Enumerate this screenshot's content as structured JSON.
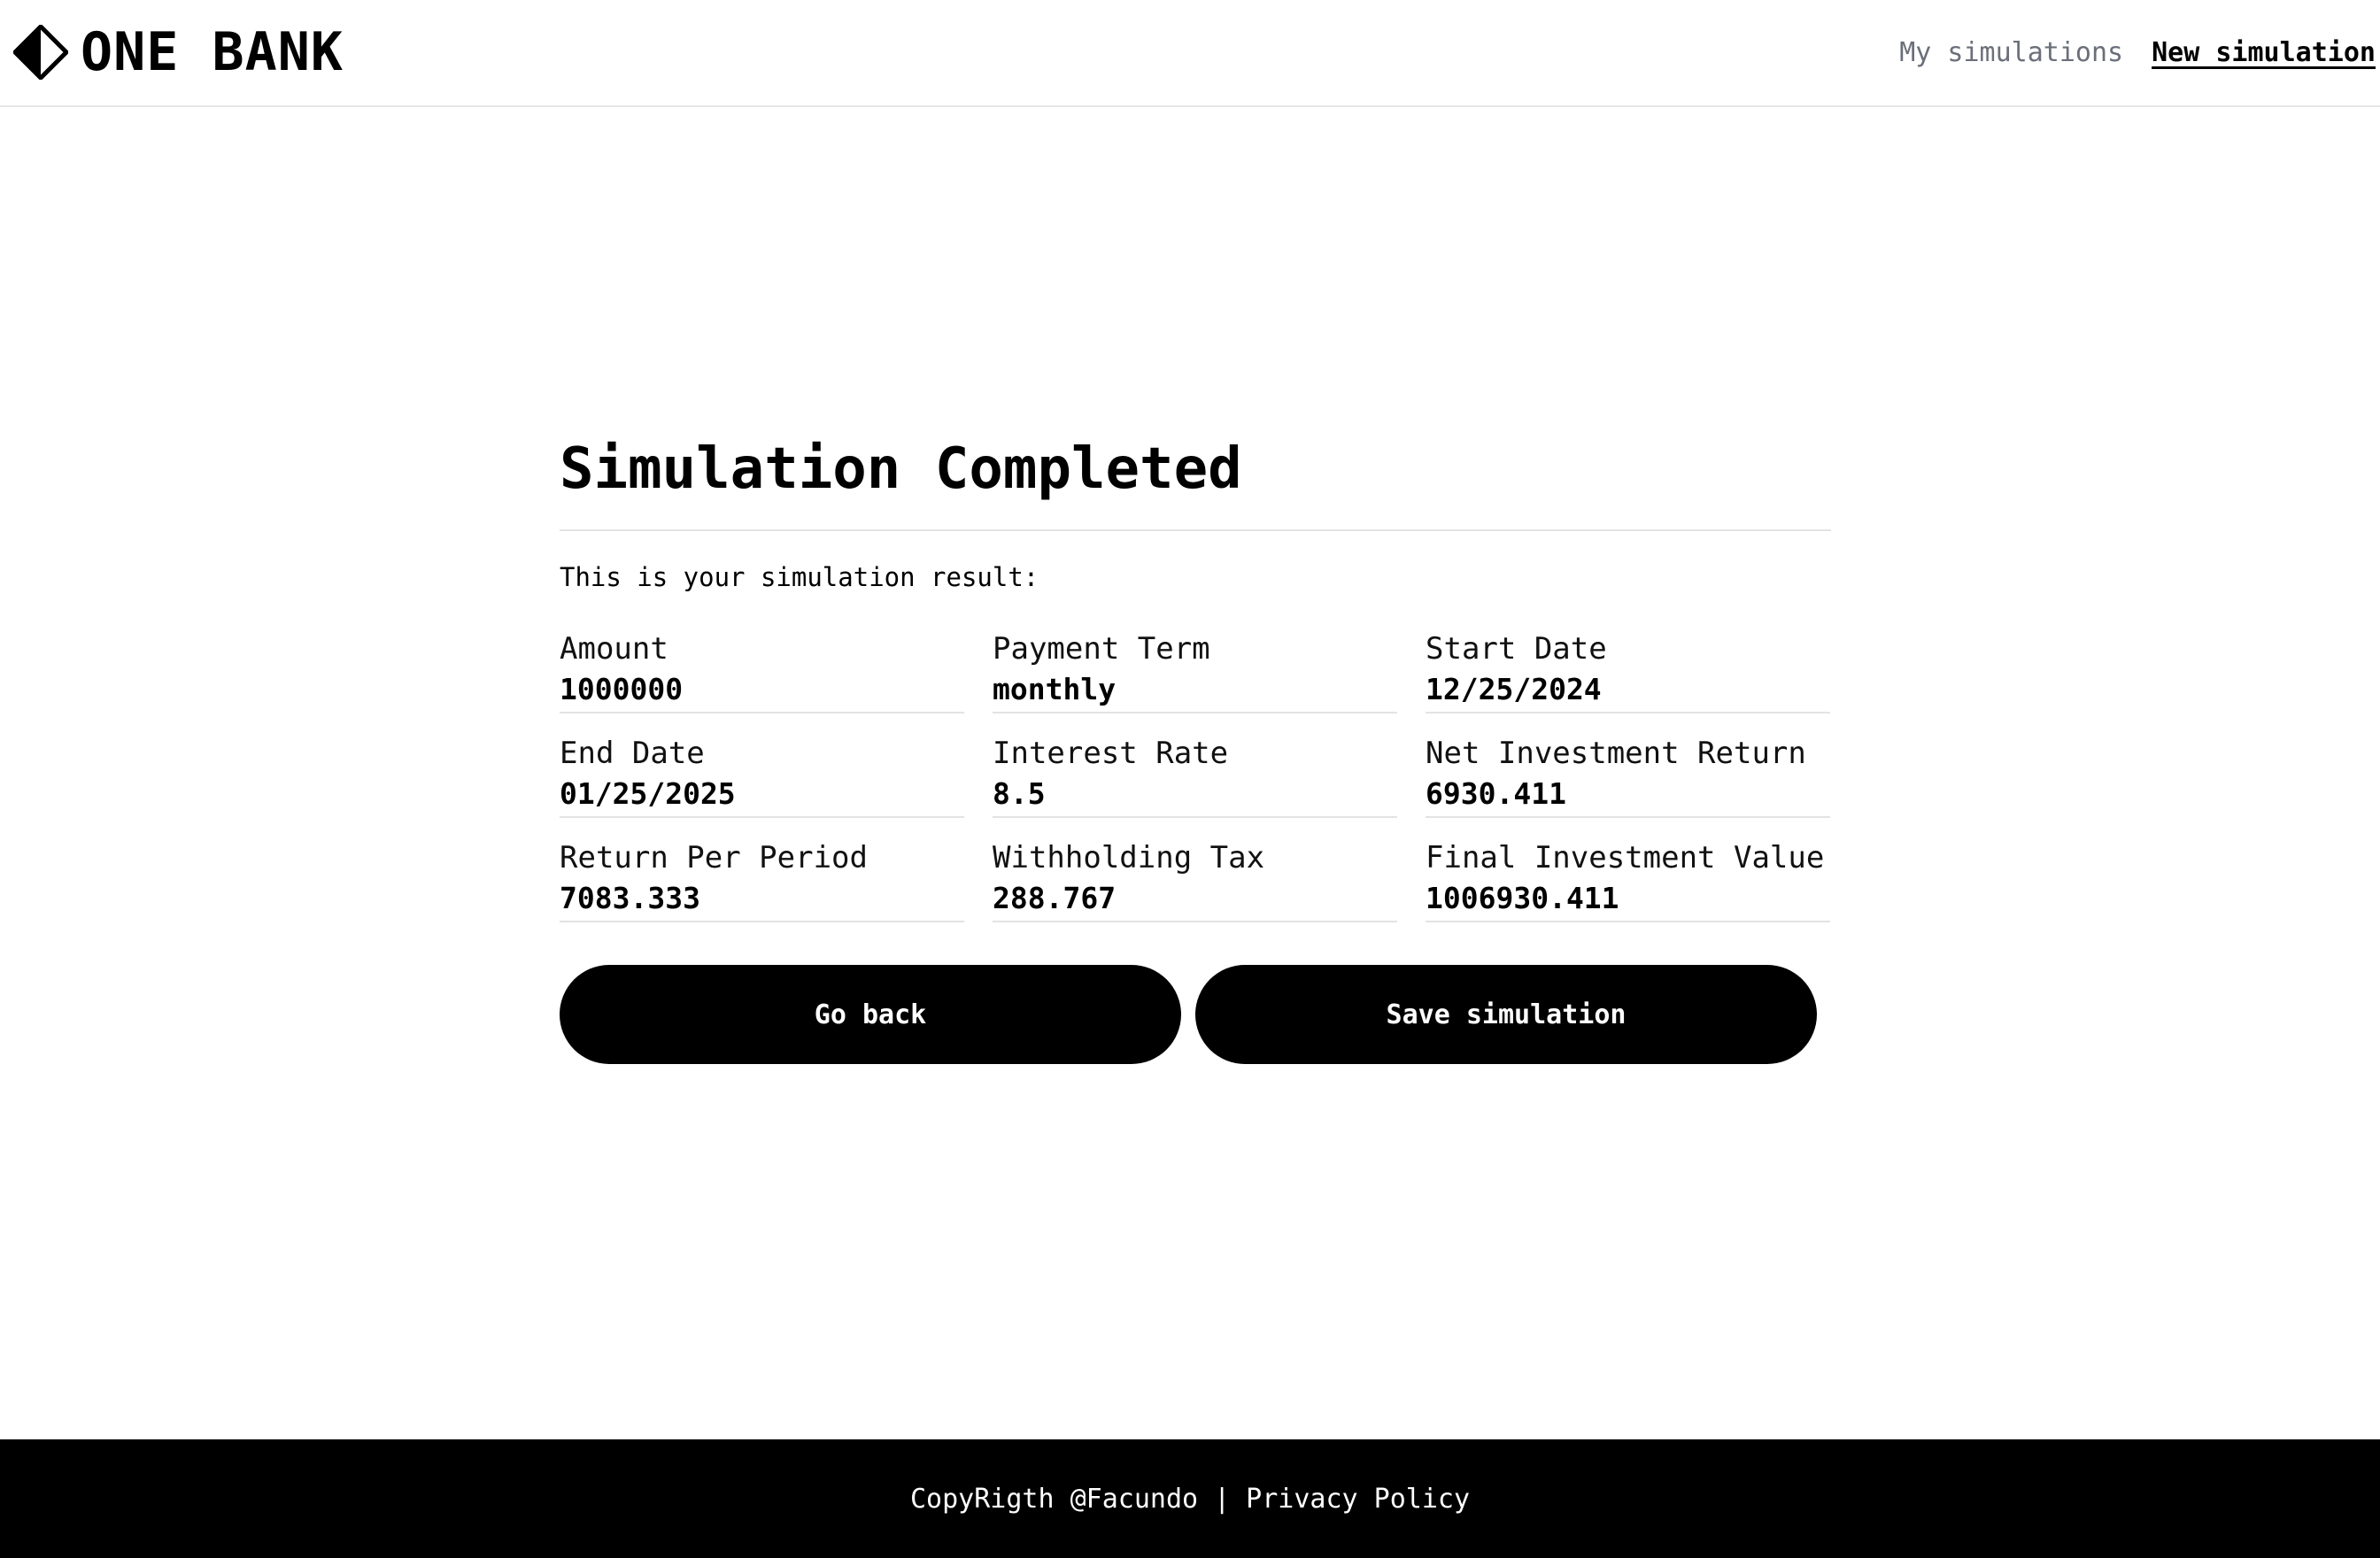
{
  "header": {
    "brand": "ONE BANK",
    "logo_icon": "diamond-half-logo-icon",
    "nav": {
      "my_simulations": "My simulations",
      "new_simulation": "New simulation"
    }
  },
  "main": {
    "title": "Simulation Completed",
    "subtitle": "This is your simulation result:",
    "fields": [
      {
        "label": "Amount",
        "value": "1000000"
      },
      {
        "label": "Payment Term",
        "value": "monthly"
      },
      {
        "label": "Start Date",
        "value": "12/25/2024"
      },
      {
        "label": "End Date",
        "value": "01/25/2025"
      },
      {
        "label": "Interest Rate",
        "value": "8.5"
      },
      {
        "label": "Net Investment Return",
        "value": "6930.411"
      },
      {
        "label": "Return Per Period",
        "value": "7083.333"
      },
      {
        "label": "Withholding Tax",
        "value": "288.767"
      },
      {
        "label": "Final Investment Value",
        "value": "1006930.411"
      }
    ],
    "buttons": {
      "go_back": "Go back",
      "save": "Save simulation"
    }
  },
  "footer": {
    "copyright": "CopyRigth @Facundo",
    "separator": "|",
    "privacy": "Privacy Policy"
  }
}
